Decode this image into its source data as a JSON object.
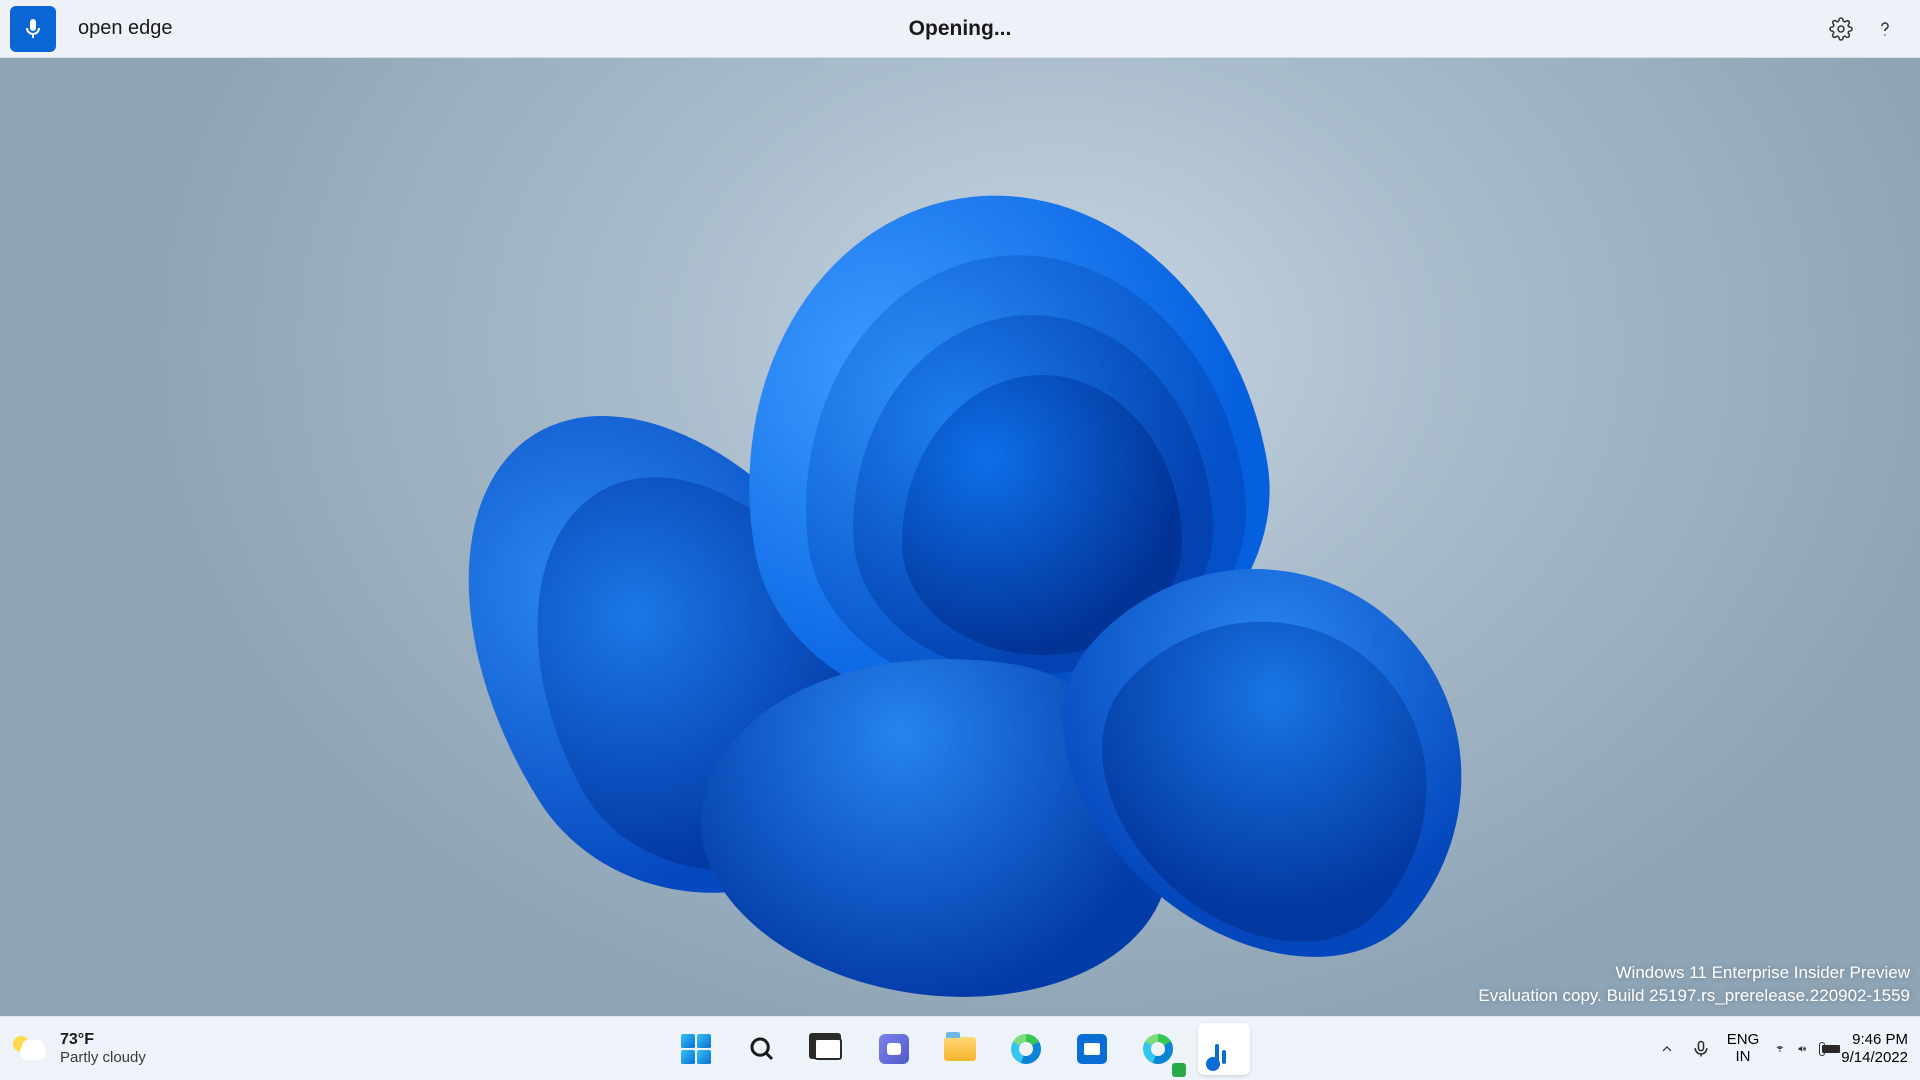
{
  "voice_bar": {
    "command_text": "open edge",
    "status_text": "Opening..."
  },
  "watermark": {
    "line1": "Windows 11 Enterprise Insider Preview",
    "line2": "Evaluation copy. Build 25197.rs_prerelease.220902-1559"
  },
  "weather": {
    "temperature": "73°F",
    "condition": "Partly cloudy"
  },
  "language": {
    "lang": "ENG",
    "region": "IN"
  },
  "clock": {
    "time": "9:46 PM",
    "date": "9/14/2022"
  },
  "taskbar_apps": [
    {
      "name": "start",
      "label": "Start"
    },
    {
      "name": "search",
      "label": "Search"
    },
    {
      "name": "task-view",
      "label": "Task View"
    },
    {
      "name": "chat",
      "label": "Chat"
    },
    {
      "name": "file-explorer",
      "label": "File Explorer"
    },
    {
      "name": "edge",
      "label": "Microsoft Edge"
    },
    {
      "name": "store",
      "label": "Microsoft Store"
    },
    {
      "name": "edge-dev",
      "label": "Microsoft Edge Dev"
    },
    {
      "name": "voice-access",
      "label": "Voice Access",
      "active": true
    }
  ]
}
